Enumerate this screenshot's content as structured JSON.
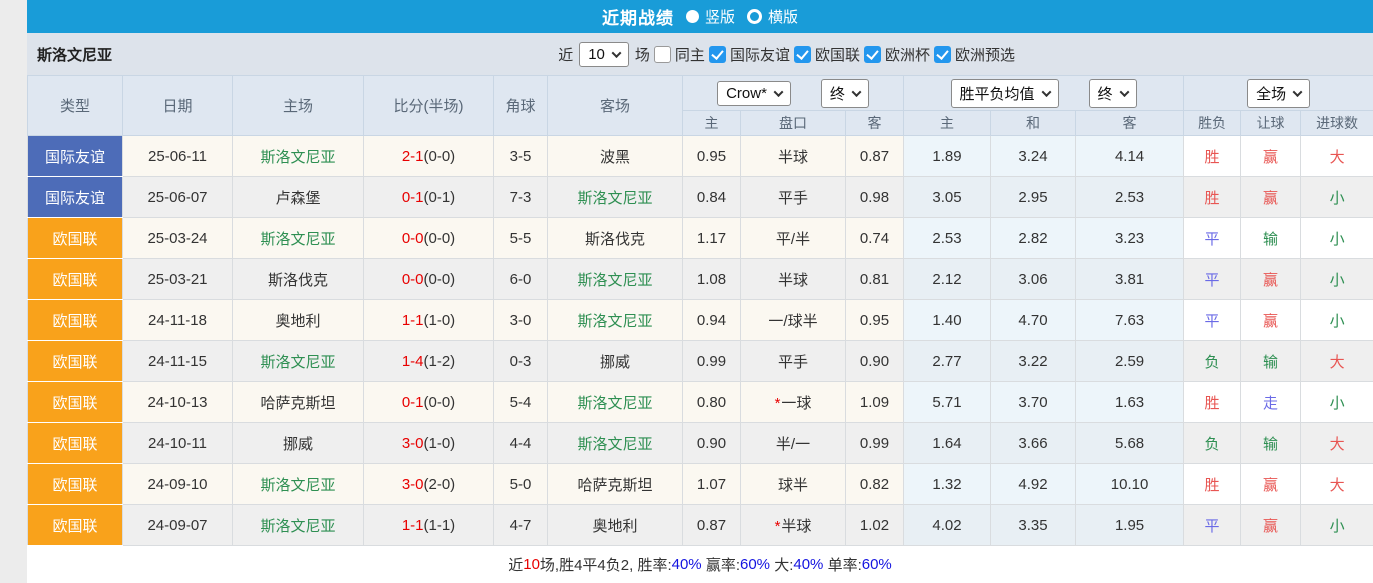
{
  "topbar": {
    "title": "近期战绩",
    "radios": [
      {
        "label": "竖版",
        "selected": true
      },
      {
        "label": "横版",
        "selected": false
      }
    ]
  },
  "filterbar": {
    "team": "斯洛文尼亚",
    "recent_label": "近",
    "recent_count": "10",
    "games_label": "场",
    "same_home": {
      "label": "同主",
      "checked": false
    },
    "competitions": [
      {
        "label": "国际友谊",
        "checked": true
      },
      {
        "label": "欧国联",
        "checked": true
      },
      {
        "label": "欧洲杯",
        "checked": true
      },
      {
        "label": "欧洲预选",
        "checked": true
      }
    ]
  },
  "table": {
    "main_headers": [
      "类型",
      "日期",
      "主场",
      "比分(半场)",
      "角球",
      "客场"
    ],
    "odds_selects": {
      "company": "Crow*",
      "time": "终"
    },
    "avg_selects": {
      "metric": "胜平负均值",
      "time": "终"
    },
    "result_select": {
      "scope": "全场"
    },
    "sub_headers": [
      "主",
      "盘口",
      "客",
      "主",
      "和",
      "客",
      "胜负",
      "让球",
      "进球数"
    ],
    "rows": [
      {
        "type": "国际友谊",
        "type_color": "blue",
        "date": "25-06-11",
        "home": "斯洛文尼亚",
        "home_team": true,
        "score_ft": "2-1",
        "score_ht": "(0-0)",
        "corner": "3-5",
        "away": "波黑",
        "away_team": false,
        "odds_home": "0.95",
        "handicap": "半球",
        "handicap_star": false,
        "odds_away": "0.87",
        "avg": [
          "1.89",
          "3.24",
          "4.14"
        ],
        "results": [
          {
            "t": "胜",
            "c": "red"
          },
          {
            "t": "赢",
            "c": "red"
          },
          {
            "t": "大",
            "c": "red"
          }
        ]
      },
      {
        "type": "国际友谊",
        "type_color": "blue",
        "date": "25-06-07",
        "home": "卢森堡",
        "home_team": false,
        "score_ft": "0-1",
        "score_ht": "(0-1)",
        "corner": "7-3",
        "away": "斯洛文尼亚",
        "away_team": true,
        "odds_home": "0.84",
        "handicap": "平手",
        "handicap_star": false,
        "odds_away": "0.98",
        "avg": [
          "3.05",
          "2.95",
          "2.53"
        ],
        "results": [
          {
            "t": "胜",
            "c": "red"
          },
          {
            "t": "赢",
            "c": "red"
          },
          {
            "t": "小",
            "c": "green"
          }
        ]
      },
      {
        "type": "欧国联",
        "type_color": "orange",
        "date": "25-03-24",
        "home": "斯洛文尼亚",
        "home_team": true,
        "score_ft": "0-0",
        "score_ht": "(0-0)",
        "corner": "5-5",
        "away": "斯洛伐克",
        "away_team": false,
        "odds_home": "1.17",
        "handicap": "平/半",
        "handicap_star": false,
        "odds_away": "0.74",
        "avg": [
          "2.53",
          "2.82",
          "3.23"
        ],
        "results": [
          {
            "t": "平",
            "c": "blue"
          },
          {
            "t": "输",
            "c": "green"
          },
          {
            "t": "小",
            "c": "green"
          }
        ]
      },
      {
        "type": "欧国联",
        "type_color": "orange",
        "date": "25-03-21",
        "home": "斯洛伐克",
        "home_team": false,
        "score_ft": "0-0",
        "score_ht": "(0-0)",
        "corner": "6-0",
        "away": "斯洛文尼亚",
        "away_team": true,
        "odds_home": "1.08",
        "handicap": "半球",
        "handicap_star": false,
        "odds_away": "0.81",
        "avg": [
          "2.12",
          "3.06",
          "3.81"
        ],
        "results": [
          {
            "t": "平",
            "c": "blue"
          },
          {
            "t": "赢",
            "c": "red"
          },
          {
            "t": "小",
            "c": "green"
          }
        ]
      },
      {
        "type": "欧国联",
        "type_color": "orange",
        "date": "24-11-18",
        "home": "奥地利",
        "home_team": false,
        "score_ft": "1-1",
        "score_ht": "(1-0)",
        "corner": "3-0",
        "away": "斯洛文尼亚",
        "away_team": true,
        "odds_home": "0.94",
        "handicap": "一/球半",
        "handicap_star": false,
        "odds_away": "0.95",
        "avg": [
          "1.40",
          "4.70",
          "7.63"
        ],
        "results": [
          {
            "t": "平",
            "c": "blue"
          },
          {
            "t": "赢",
            "c": "red"
          },
          {
            "t": "小",
            "c": "green"
          }
        ]
      },
      {
        "type": "欧国联",
        "type_color": "orange",
        "date": "24-11-15",
        "home": "斯洛文尼亚",
        "home_team": true,
        "score_ft": "1-4",
        "score_ht": "(1-2)",
        "corner": "0-3",
        "away": "挪威",
        "away_team": false,
        "odds_home": "0.99",
        "handicap": "平手",
        "handicap_star": false,
        "odds_away": "0.90",
        "avg": [
          "2.77",
          "3.22",
          "2.59"
        ],
        "results": [
          {
            "t": "负",
            "c": "green"
          },
          {
            "t": "输",
            "c": "green"
          },
          {
            "t": "大",
            "c": "red"
          }
        ]
      },
      {
        "type": "欧国联",
        "type_color": "orange",
        "date": "24-10-13",
        "home": "哈萨克斯坦",
        "home_team": false,
        "score_ft": "0-1",
        "score_ht": "(0-0)",
        "corner": "5-4",
        "away": "斯洛文尼亚",
        "away_team": true,
        "odds_home": "0.80",
        "handicap": "一球",
        "handicap_star": true,
        "odds_away": "1.09",
        "avg": [
          "5.71",
          "3.70",
          "1.63"
        ],
        "results": [
          {
            "t": "胜",
            "c": "red"
          },
          {
            "t": "走",
            "c": "blue"
          },
          {
            "t": "小",
            "c": "green"
          }
        ]
      },
      {
        "type": "欧国联",
        "type_color": "orange",
        "date": "24-10-11",
        "home": "挪威",
        "home_team": false,
        "score_ft": "3-0",
        "score_ht": "(1-0)",
        "corner": "4-4",
        "away": "斯洛文尼亚",
        "away_team": true,
        "odds_home": "0.90",
        "handicap": "半/一",
        "handicap_star": false,
        "odds_away": "0.99",
        "avg": [
          "1.64",
          "3.66",
          "5.68"
        ],
        "results": [
          {
            "t": "负",
            "c": "green"
          },
          {
            "t": "输",
            "c": "green"
          },
          {
            "t": "大",
            "c": "red"
          }
        ]
      },
      {
        "type": "欧国联",
        "type_color": "orange",
        "date": "24-09-10",
        "home": "斯洛文尼亚",
        "home_team": true,
        "score_ft": "3-0",
        "score_ht": "(2-0)",
        "corner": "5-0",
        "away": "哈萨克斯坦",
        "away_team": false,
        "odds_home": "1.07",
        "handicap": "球半",
        "handicap_star": false,
        "odds_away": "0.82",
        "avg": [
          "1.32",
          "4.92",
          "10.10"
        ],
        "results": [
          {
            "t": "胜",
            "c": "red"
          },
          {
            "t": "赢",
            "c": "red"
          },
          {
            "t": "大",
            "c": "red"
          }
        ]
      },
      {
        "type": "欧国联",
        "type_color": "orange",
        "date": "24-09-07",
        "home": "斯洛文尼亚",
        "home_team": true,
        "score_ft": "1-1",
        "score_ht": "(1-1)",
        "corner": "4-7",
        "away": "奥地利",
        "away_team": false,
        "odds_home": "0.87",
        "handicap": "半球",
        "handicap_star": true,
        "odds_away": "1.02",
        "avg": [
          "4.02",
          "3.35",
          "1.95"
        ],
        "results": [
          {
            "t": "平",
            "c": "blue"
          },
          {
            "t": "赢",
            "c": "red"
          },
          {
            "t": "小",
            "c": "green"
          }
        ]
      }
    ]
  },
  "footer": {
    "segments": [
      {
        "t": "近",
        "c": "dark"
      },
      {
        "t": "10",
        "c": "red"
      },
      {
        "t": "场,胜4平4负2, 胜率:",
        "c": "dark"
      },
      {
        "t": "40%",
        "c": "blue"
      },
      {
        "t": " 赢率:",
        "c": "dark"
      },
      {
        "t": "60%",
        "c": "blue"
      },
      {
        "t": " 大:",
        "c": "dark"
      },
      {
        "t": "40%",
        "c": "blue"
      },
      {
        "t": " 单率:",
        "c": "dark"
      },
      {
        "t": "60%",
        "c": "blue"
      }
    ]
  },
  "colors": {
    "topbar_bg": "#199cd8",
    "badge_friendly": "#4d6cb8",
    "badge_nations_league": "#f9a21b",
    "score_red": "#e80000",
    "result_red": "#e85552",
    "result_green": "#52a164",
    "result_blue": "#6a6ae6",
    "team_green": "#2e8f52",
    "footer_blue": "#1414e0"
  }
}
